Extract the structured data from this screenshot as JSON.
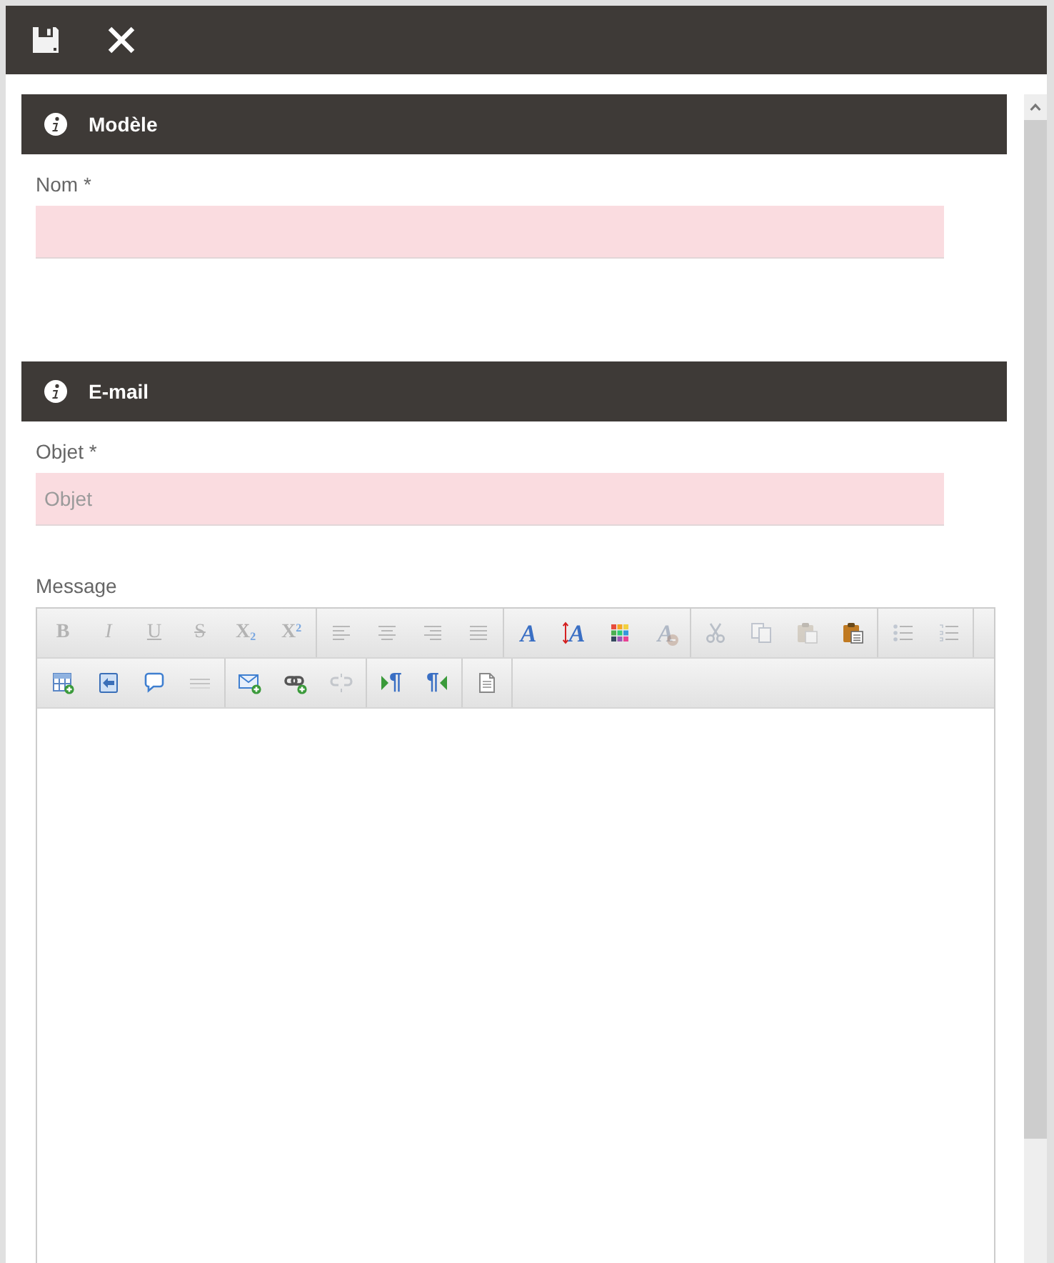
{
  "toolbar": {
    "buttons": [
      {
        "kind": "save"
      },
      {
        "kind": "close"
      }
    ]
  },
  "sections": [
    {
      "title": "Modèle",
      "fields": [
        {
          "kind": "input",
          "label": "Nom *",
          "invalid": true
        }
      ]
    },
    {
      "title": "E-mail",
      "fields": [
        {
          "kind": "input",
          "label": "Objet *",
          "placeholder": "Objet",
          "invalid": true
        },
        {
          "kind": "editor",
          "label": "Message",
          "toolbar_rows": [
            [
              [
                {
                  "kind": "bold",
                  "glyph": "B",
                  "disabled": true
                },
                {
                  "kind": "italic",
                  "glyph": "I",
                  "disabled": true
                },
                {
                  "kind": "underline",
                  "glyph": "U",
                  "disabled": true
                },
                {
                  "kind": "strikethrough",
                  "glyph": "S",
                  "disabled": true
                },
                {
                  "kind": "subscript",
                  "glyph": "X$_{2}$",
                  "disabled": true
                },
                {
                  "kind": "superscript",
                  "glyph": "X$^{2}$",
                  "disabled": true
                }
              ],
              [
                {
                  "kind": "align-left",
                  "disabled": true
                },
                {
                  "kind": "align-center",
                  "disabled": true
                },
                {
                  "kind": "align-right",
                  "disabled": true
                },
                {
                  "kind": "align-justify",
                  "disabled": true
                }
              ],
              [
                {
                  "kind": "font",
                  "glyph": "A",
                  "disabled": false
                },
                {
                  "kind": "font-size",
                  "glyph": "A",
                  "disabled": false
                },
                {
                  "kind": "text-color",
                  "disabled": false
                },
                {
                  "kind": "clear-format",
                  "glyph": "A",
                  "disabled": true
                }
              ],
              [
                {
                  "kind": "cut",
                  "disabled": true
                },
                {
                  "kind": "copy",
                  "disabled": true
                },
                {
                  "kind": "paste",
                  "disabled": true
                },
                {
                  "kind": "paste-special",
                  "disabled": false
                }
              ],
              [
                {
                  "kind": "bullet-list",
                  "disabled": true
                },
                {
                  "kind": "numbered-list",
                  "disabled": true
                }
              ]
            ],
            [
              [
                {
                  "kind": "table",
                  "disabled": false
                },
                {
                  "kind": "image",
                  "disabled": false
                },
                {
                  "kind": "comment",
                  "disabled": false
                },
                {
                  "kind": "horizontal-rule",
                  "disabled": true
                }
              ],
              [
                {
                  "kind": "email",
                  "disabled": false
                },
                {
                  "kind": "link",
                  "disabled": false
                },
                {
                  "kind": "unlink",
                  "disabled": true
                }
              ],
              [
                {
                  "kind": "ltr",
                  "glyph": "¶",
                  "disabled": false
                },
                {
                  "kind": "rtl",
                  "glyph": "¶",
                  "disabled": false
                }
              ],
              [
                {
                  "kind": "source",
                  "disabled": false
                }
              ]
            ]
          ]
        }
      ]
    }
  ]
}
